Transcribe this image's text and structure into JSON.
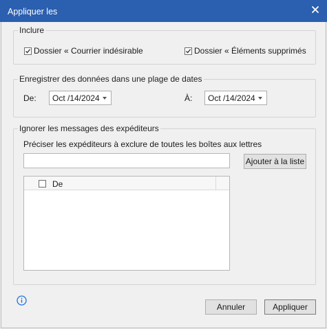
{
  "window": {
    "title": "Appliquer les"
  },
  "include": {
    "legend": "Inclure",
    "junk_label": "Dossier « Courrier indésirable",
    "junk_checked": true,
    "deleted_label": "Dossier « Éléments supprimés",
    "deleted_checked": true
  },
  "date_range": {
    "legend": "Enregistrer des données dans une plage de dates",
    "from_label": "De:",
    "from_value": "Oct /14/2024",
    "to_label": "À:",
    "to_value": "Oct /14/2024"
  },
  "ignore": {
    "legend": "Ignorer les messages des expéditeurs",
    "instruction": "Préciser les expéditeurs à exclure de toutes les boîtes aux lettres",
    "input_value": "",
    "add_button": "Ajouter à la liste",
    "list_header": "De",
    "list_items": []
  },
  "footer": {
    "cancel": "Annuler",
    "apply": "Appliquer"
  },
  "colors": {
    "titlebar": "#2b5faf",
    "info_icon": "#1a73e8"
  },
  "icons": {
    "close": "close-icon",
    "info": "info-icon",
    "checkmark": "checkmark-icon",
    "dropdown": "chevron-down-icon"
  }
}
